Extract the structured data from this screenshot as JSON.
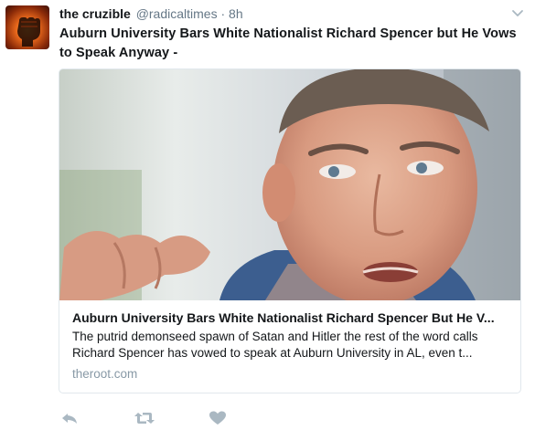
{
  "tweet": {
    "author_name": "the cruzible",
    "handle": "@radicaltimes",
    "separator": "·",
    "time": "8h",
    "text": "Auburn University Bars White Nationalist Richard Spencer but He Vows to Speak Anyway -",
    "avatar_icon": "raised-fist-icon"
  },
  "card": {
    "title": "Auburn University Bars White Nationalist Richard Spencer But He V...",
    "description": "The putrid demonseed spawn of Satan and Hitler the rest of the word calls Richard Spencer has vowed to speak at Auburn University in AL, even t...",
    "domain": "theroot.com"
  },
  "actions": {
    "reply_icon": "reply-icon",
    "retweet_icon": "retweet-icon",
    "like_icon": "heart-icon",
    "menu_icon": "chevron-down-icon"
  },
  "colors": {
    "text": "#14171a",
    "secondary": "#657786",
    "domain": "#8899a6",
    "border": "#e1e8ed",
    "icon": "#aab8c2"
  }
}
